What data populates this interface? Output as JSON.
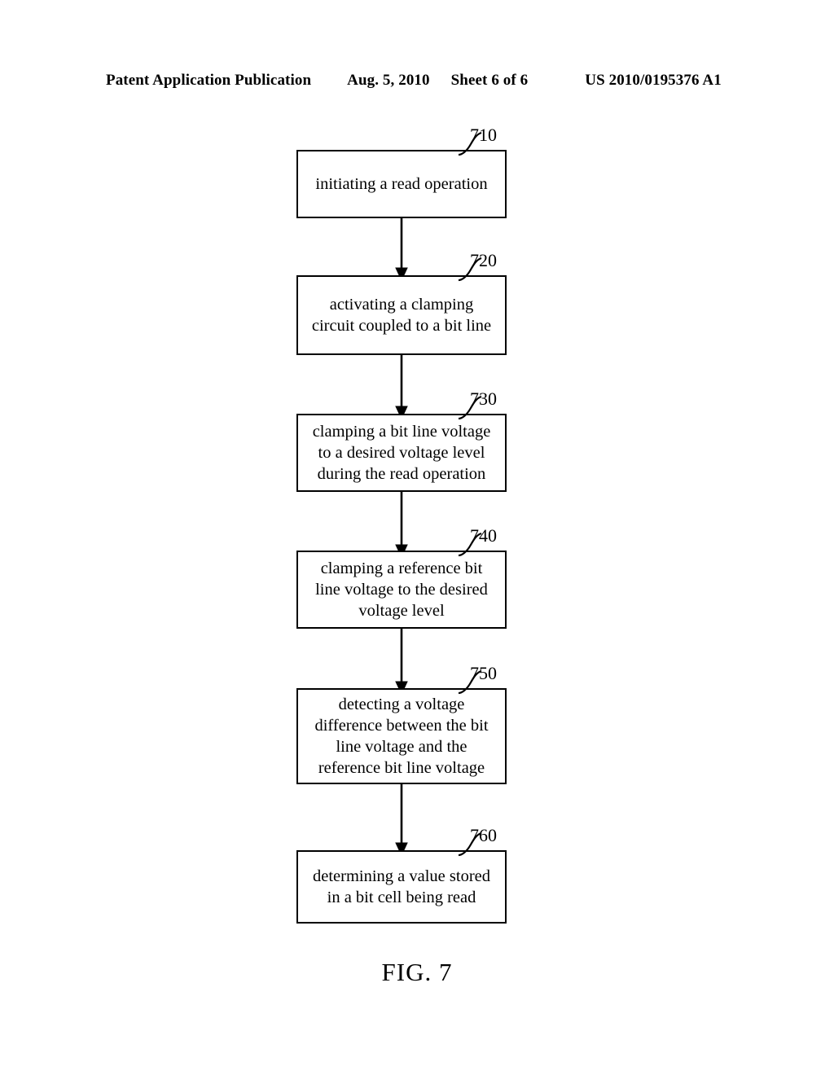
{
  "header": {
    "publication": "Patent Application Publication",
    "date": "Aug. 5, 2010",
    "sheet": "Sheet 6 of 6",
    "patent_number": "US 2010/0195376 A1"
  },
  "figure": {
    "caption": "FIG. 7",
    "type": "flowchart",
    "orientation": "vertical",
    "steps": [
      {
        "ref": "710",
        "text": "initiating a read operation"
      },
      {
        "ref": "720",
        "text": "activating a clamping\ncircuit coupled to a bit line"
      },
      {
        "ref": "730",
        "text": "clamping a bit line voltage\nto a desired voltage level\nduring the read operation"
      },
      {
        "ref": "740",
        "text": "clamping a reference bit\nline voltage to the desired\nvoltage level"
      },
      {
        "ref": "750",
        "text": "detecting a voltage\ndifference between the bit\nline voltage and the\nreference bit line voltage"
      },
      {
        "ref": "760",
        "text": "determining a value stored\nin a bit cell being read"
      }
    ]
  },
  "colors": {
    "ink": "#000000",
    "paper": "#ffffff"
  }
}
